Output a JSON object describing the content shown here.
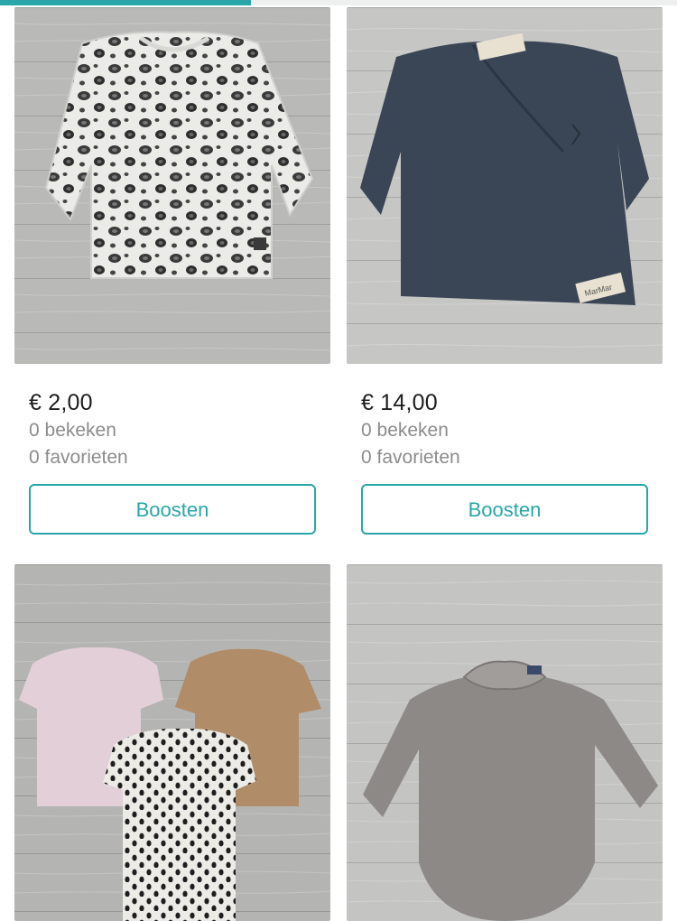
{
  "scroll_progress": 0.37,
  "colors": {
    "accent": "#2aa6a8",
    "price": "#1d1d1d",
    "meta": "#8c8c8c"
  },
  "items": [
    {
      "price": "€ 2,00",
      "views": "0 bekeken",
      "favorites": "0 favorieten",
      "boost_label": "Boosten",
      "image": "leopard-print-longsleeve-photo"
    },
    {
      "price": "€ 14,00",
      "views": "0 bekeken",
      "favorites": "0 favorieten",
      "boost_label": "Boosten",
      "image": "navy-wrap-cardigan-photo",
      "brand_tag": "MarMar"
    },
    {
      "image": "three-baby-tshirts-photo"
    },
    {
      "image": "grey-ruffle-collar-bodysuit-photo"
    }
  ]
}
